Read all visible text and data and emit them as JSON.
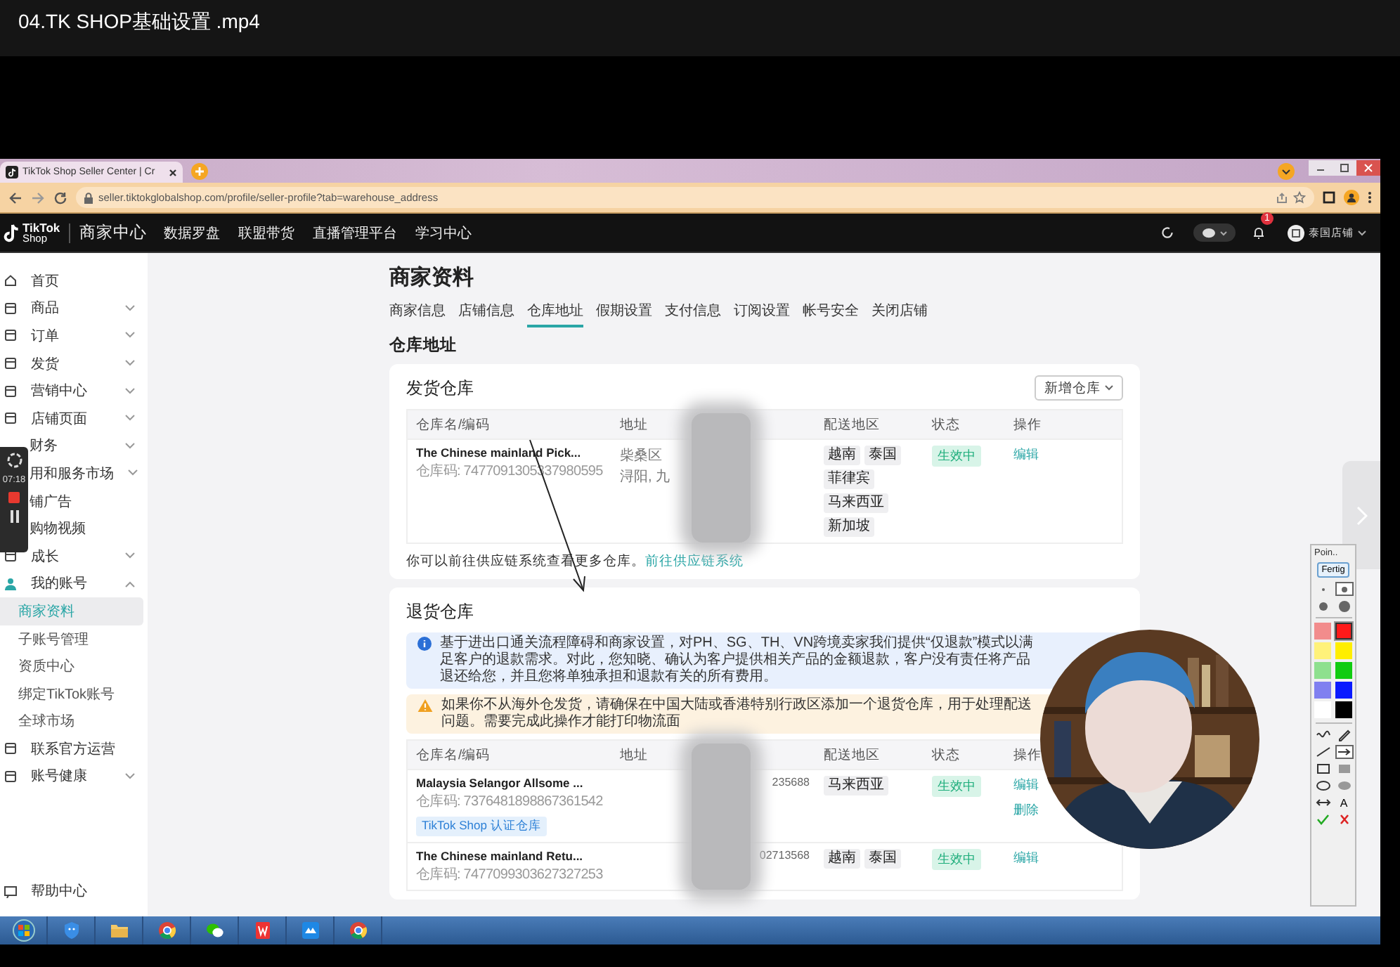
{
  "player": {
    "title": "04.TK SHOP基础设置 .mp4"
  },
  "browser": {
    "tab_title": "TikTok Shop Seller Center | Cr",
    "url": "seller.tiktokglobalshop.com/profile/seller-profile?tab=warehouse_address"
  },
  "header": {
    "logo": "TikTok",
    "logo_sub": "Shop",
    "nav": [
      "商家中心",
      "数据罗盘",
      "联盟带货",
      "直播管理平台",
      "学习中心"
    ],
    "notification_count": "1",
    "shop_name": "泰国店铺"
  },
  "sidebar": {
    "items": [
      {
        "label": "首页",
        "kind": "link"
      },
      {
        "label": "商品",
        "kind": "group",
        "expanded": false
      },
      {
        "label": "订单",
        "kind": "group",
        "expanded": false
      },
      {
        "label": "发货",
        "kind": "group",
        "expanded": false
      },
      {
        "label": "营销中心",
        "kind": "group",
        "expanded": false
      },
      {
        "label": "店铺页面",
        "kind": "group",
        "expanded": false
      },
      {
        "label": "财务",
        "kind": "group",
        "expanded": false
      },
      {
        "label": "用和服务市场",
        "kind": "group",
        "expanded": false
      },
      {
        "label": "铺广告",
        "kind": "link"
      },
      {
        "label": "购物视频",
        "kind": "link"
      },
      {
        "label": "成长",
        "kind": "group",
        "expanded": false
      },
      {
        "label": "我的账号",
        "kind": "group",
        "expanded": true,
        "children": [
          {
            "label": "商家资料",
            "selected": true
          },
          {
            "label": "子账号管理",
            "selected": false
          },
          {
            "label": "资质中心",
            "selected": false
          },
          {
            "label": "绑定TikTok账号",
            "selected": false
          },
          {
            "label": "全球市场",
            "selected": false
          }
        ]
      },
      {
        "label": "联系官方运营",
        "kind": "link"
      },
      {
        "label": "账号健康",
        "kind": "group",
        "expanded": false
      }
    ],
    "help": "帮助中心"
  },
  "main": {
    "page_title": "商家资料",
    "tabs": [
      {
        "label": "商家信息",
        "selected": false
      },
      {
        "label": "店铺信息",
        "selected": false
      },
      {
        "label": "仓库地址",
        "selected": true
      },
      {
        "label": "假期设置",
        "selected": false
      },
      {
        "label": "支付信息",
        "selected": false
      },
      {
        "label": "订阅设置",
        "selected": false
      },
      {
        "label": "帐号安全",
        "selected": false
      },
      {
        "label": "关闭店铺",
        "selected": false
      }
    ],
    "section_title": "仓库地址",
    "cards": [
      {
        "title": "发货仓库",
        "add_button": "新增仓库",
        "columns": [
          "仓库名/编码",
          "地址",
          "配送地区",
          "状态",
          "操作"
        ],
        "rows": [
          {
            "name": "The Chinese mainland Pick...",
            "code": "仓库码: 7477091305337980595",
            "address": [
              "柴桑区",
              "浔阳, 九"
            ],
            "regions": [
              "越南",
              "泰国",
              "菲律宾",
              "马来西亚",
              "新加坡"
            ],
            "status": "生效中",
            "actions": [
              "编辑"
            ]
          }
        ],
        "footer_text": "你可以前往供应链系统查看更多仓库。",
        "footer_link": "前往供应链系统"
      },
      {
        "title": "退货仓库",
        "info": "基于进出口通关流程障碍和商家设置，对PH、SG、TH、VN跨境卖家我们提供“仅退款”模式以满足客户的退款需求。对此，您知晓、确认为客户提供相关产品的金额退款，客户没有责任将产品退还给您，并且您将单独承担和退款有关的所有费用。",
        "warning": "如果你不从海外仓发货，请确保在中国大陆或香港特别行政区添加一个退货仓库，用于处理配送问题。需要完成此操作才能打印物流面",
        "columns": [
          "仓库名/编码",
          "地址",
          "配送地区",
          "状态",
          "操作"
        ],
        "rows": [
          {
            "name": "Malaysia Selangor Allsome ...",
            "code": "仓库码: 7376481898867361542",
            "tag": "TikTok Shop 认证仓库",
            "phone": "235688",
            "regions": [
              "马来西亚"
            ],
            "status": "生效中",
            "actions": [
              "编辑",
              "删除"
            ]
          },
          {
            "name": "The Chinese mainland Retu...",
            "code": "仓库码: 7477099303627327253",
            "phone": "02713568",
            "regions": [
              "越南",
              "泰国"
            ],
            "status": "生效中",
            "actions": [
              "编辑"
            ]
          }
        ]
      }
    ]
  },
  "recorder": {
    "time": "07:18"
  },
  "paint_toolbar": {
    "title": "Poin..",
    "done_button": "Fertig",
    "sizes": [
      {
        "kind": "dot-s",
        "selected": false
      },
      {
        "kind": "dot-m",
        "selected": true
      },
      {
        "kind": "dot-l",
        "selected": false
      },
      {
        "kind": "dot-xl",
        "selected": false
      }
    ],
    "colors": [
      {
        "color": "#f28c8c",
        "selected": false
      },
      {
        "color": "#ff1a1a",
        "selected": true
      },
      {
        "color": "#fff27a",
        "selected": false
      },
      {
        "color": "#ffee00",
        "selected": false
      },
      {
        "color": "#8ee08e",
        "selected": false
      },
      {
        "color": "#11cc11",
        "selected": false
      },
      {
        "color": "#8080f0",
        "selected": false
      },
      {
        "color": "#0a1aff",
        "selected": false
      },
      {
        "color": "#ffffff",
        "selected": false
      },
      {
        "color": "#000000",
        "selected": false
      }
    ],
    "tools": [
      {
        "kind": "wave",
        "selected": false
      },
      {
        "kind": "pencil",
        "selected": false
      },
      {
        "kind": "line",
        "selected": false
      },
      {
        "kind": "arrow",
        "selected": true
      },
      {
        "kind": "rect",
        "selected": false
      },
      {
        "kind": "rect-fill",
        "selected": false
      },
      {
        "kind": "ellipse",
        "selected": false
      },
      {
        "kind": "ellipse-fill",
        "selected": false
      },
      {
        "kind": "double-arrow",
        "selected": false
      },
      {
        "kind": "text",
        "label": "A",
        "selected": false
      },
      {
        "kind": "check",
        "selected": false
      },
      {
        "kind": "cross",
        "selected": false
      }
    ]
  }
}
